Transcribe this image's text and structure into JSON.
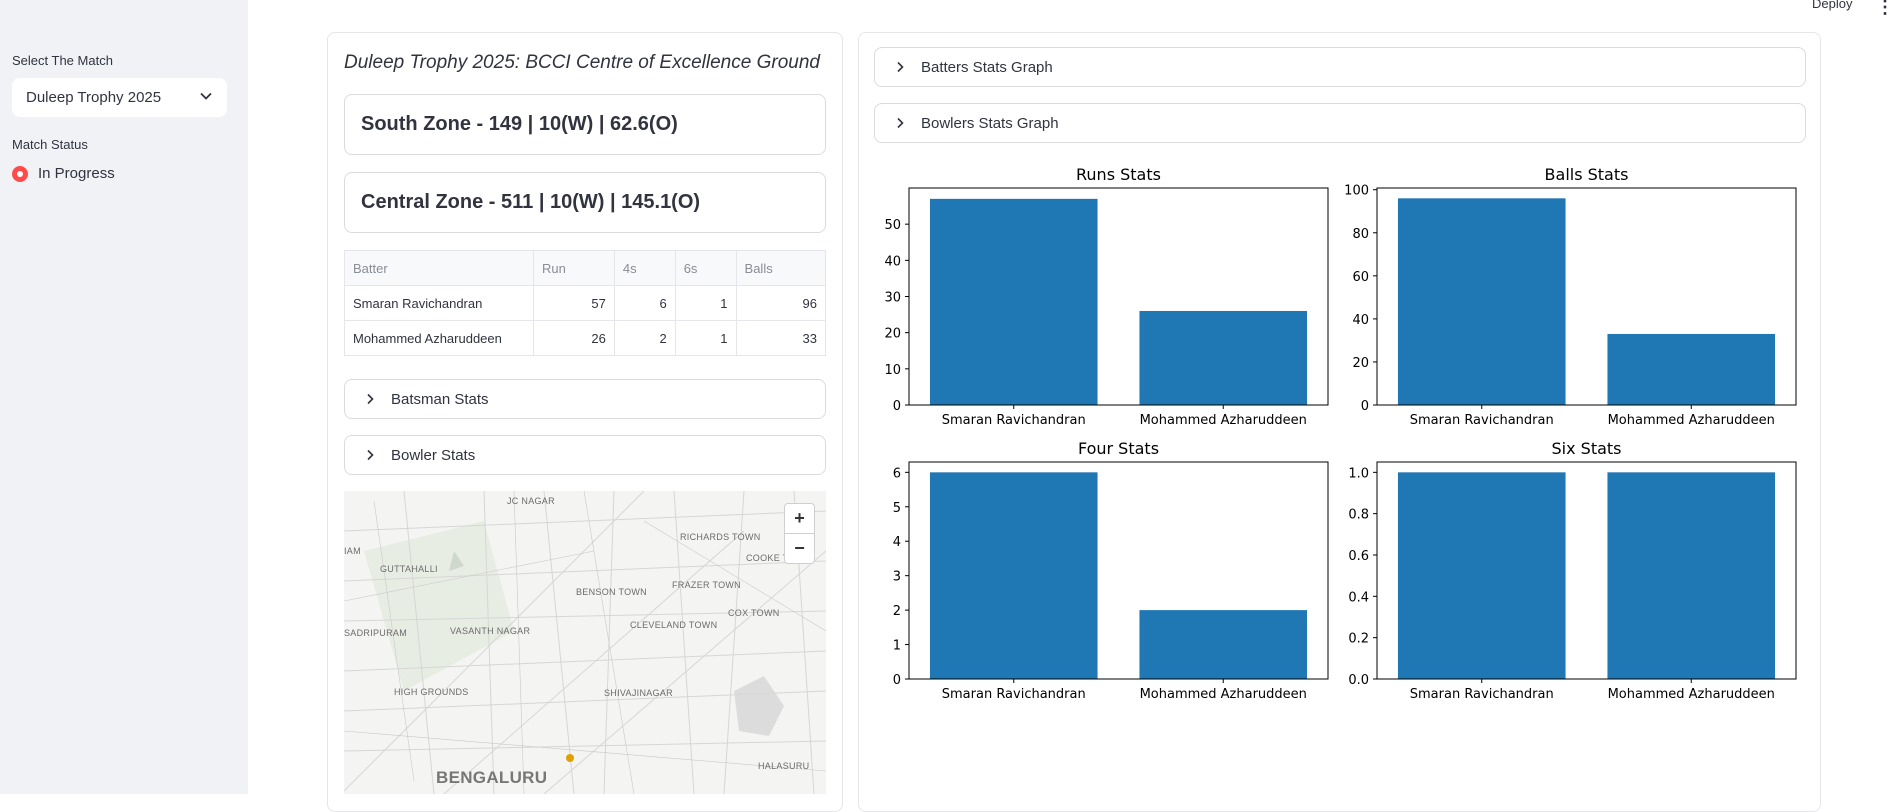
{
  "header": {
    "deploy_label": "Deploy",
    "menu_icon": "more-vertical-icon"
  },
  "sidebar": {
    "select_label": "Select The Match",
    "selected_match": "Duleep Trophy 2025",
    "status_label": "Match Status",
    "status_value": "In Progress",
    "accent": "#ff4b4b"
  },
  "left": {
    "match_title": "Duleep Trophy 2025: BCCI Centre of Excellence Ground",
    "scores": [
      "South Zone - 149 | 10(W) | 62.6(O)",
      "Central Zone - 511 | 10(W) | 145.1(O)"
    ],
    "table": {
      "headers": [
        "Batter",
        "Run",
        "4s",
        "6s",
        "Balls"
      ],
      "rows": [
        [
          "Smaran Ravichandran",
          "57",
          "6",
          "1",
          "96"
        ],
        [
          "Mohammed Azharuddeen",
          "26",
          "2",
          "1",
          "33"
        ]
      ]
    },
    "expanders": [
      "Batsman Stats",
      "Bowler Stats"
    ],
    "map": {
      "zoom_in": "+",
      "zoom_out": "−",
      "labels": [
        "JC NAGAR",
        "RICHARDS TOWN",
        "COOKE TOWN",
        "GUTTAHALLI",
        "BENSON TOWN",
        "FRAZER TOWN",
        "COX TOWN",
        "CLEVELAND TOWN",
        "SADRIPURAM",
        "VASANTH NAGAR",
        "HIGH GROUNDS",
        "SHIVAJINAGAR",
        "BENGALURU",
        "HALASURU",
        "IAM"
      ]
    }
  },
  "right": {
    "expanders": [
      "Batters Stats Graph",
      "Bowlers Stats Graph"
    ]
  },
  "chart_data": [
    {
      "type": "bar",
      "title": "Runs Stats",
      "categories": [
        "Smaran Ravichandran",
        "Mohammed Azharuddeen"
      ],
      "values": [
        57,
        26
      ],
      "ylim": [
        0,
        60
      ],
      "yticks": [
        0,
        10,
        20,
        30,
        40,
        50
      ],
      "tick_labels": [
        "0",
        "10",
        "20",
        "30",
        "40",
        "50"
      ],
      "color": "#1f77b4"
    },
    {
      "type": "bar",
      "title": "Balls Stats",
      "categories": [
        "Smaran Ravichandran",
        "Mohammed Azharuddeen"
      ],
      "values": [
        96,
        33
      ],
      "ylim": [
        0,
        100.8
      ],
      "yticks": [
        0,
        20,
        40,
        60,
        80,
        100
      ],
      "tick_labels": [
        "0",
        "20",
        "40",
        "60",
        "80",
        "100"
      ],
      "color": "#1f77b4"
    },
    {
      "type": "bar",
      "title": "Four Stats",
      "categories": [
        "Smaran Ravichandran",
        "Mohammed Azharuddeen"
      ],
      "values": [
        6,
        2
      ],
      "ylim": [
        0,
        6.3
      ],
      "yticks": [
        0,
        1,
        2,
        3,
        4,
        5,
        6
      ],
      "tick_labels": [
        "0",
        "1",
        "2",
        "3",
        "4",
        "5",
        "6"
      ],
      "color": "#1f77b4"
    },
    {
      "type": "bar",
      "title": "Six Stats",
      "categories": [
        "Smaran Ravichandran",
        "Mohammed Azharuddeen"
      ],
      "values": [
        1,
        1
      ],
      "ylim": [
        0,
        1.05
      ],
      "yticks": [
        0,
        0.2,
        0.4,
        0.6,
        0.8,
        1.0
      ],
      "tick_labels": [
        "0.0",
        "0.2",
        "0.4",
        "0.6",
        "0.8",
        "1.0"
      ],
      "color": "#1f77b4"
    }
  ]
}
